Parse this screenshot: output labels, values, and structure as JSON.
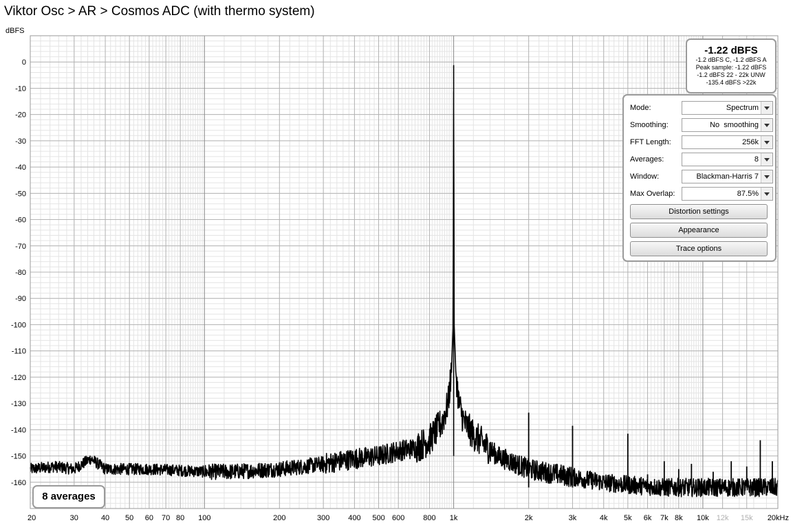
{
  "window": {
    "title": "Viktor Osc > AR > Cosmos ADC (with thermo system)"
  },
  "readout": {
    "level": "-1.22 dBFS",
    "lines": [
      "-1.2 dBFS C, -1.2 dBFS A",
      "Peak sample: -1.22 dBFS",
      "-1.2 dBFS 22 - 22k UNW",
      "-135.4 dBFS >22k"
    ]
  },
  "controls": {
    "mode": {
      "label": "Mode:",
      "value": "Spectrum"
    },
    "smoothing": {
      "label": "Smoothing:",
      "value": "No  smoothing"
    },
    "fft_length": {
      "label": "FFT Length:",
      "value": "256k"
    },
    "averages": {
      "label": "Averages:",
      "value": "8"
    },
    "window": {
      "label": "Window:",
      "value": "Blackman-Harris 7"
    },
    "max_overlap": {
      "label": "Max Overlap:",
      "value": "87.5%"
    },
    "buttons": {
      "distortion": "Distortion settings",
      "appearance": "Appearance",
      "trace": "Trace options"
    }
  },
  "status": {
    "averages_badge": "8 averages"
  },
  "colors": {
    "trace": "#000000",
    "grid_major": "#b4b4b4",
    "grid_minor": "#e4e4e4",
    "tick_gray": "#b0b0b0"
  },
  "chart_data": {
    "type": "line",
    "ylabel": "dBFS",
    "xlim": [
      20,
      20000
    ],
    "ylim": [
      -170,
      10
    ],
    "x_scale": "log",
    "grid": true,
    "y_ticks": [
      0,
      -10,
      -20,
      -30,
      -40,
      -50,
      -60,
      -70,
      -80,
      -90,
      -100,
      -110,
      -120,
      -130,
      -140,
      -150,
      -160
    ],
    "x_ticks": [
      {
        "v": 20,
        "label": "20"
      },
      {
        "v": 30,
        "label": "30"
      },
      {
        "v": 40,
        "label": "40"
      },
      {
        "v": 50,
        "label": "50"
      },
      {
        "v": 60,
        "label": "60"
      },
      {
        "v": 70,
        "label": "70"
      },
      {
        "v": 80,
        "label": "80"
      },
      {
        "v": 100,
        "label": "100"
      },
      {
        "v": 200,
        "label": "200"
      },
      {
        "v": 300,
        "label": "300"
      },
      {
        "v": 400,
        "label": "400"
      },
      {
        "v": 500,
        "label": "500"
      },
      {
        "v": 600,
        "label": "600"
      },
      {
        "v": 800,
        "label": "800"
      },
      {
        "v": 1000,
        "label": "1k"
      },
      {
        "v": 2000,
        "label": "2k"
      },
      {
        "v": 3000,
        "label": "3k"
      },
      {
        "v": 4000,
        "label": "4k"
      },
      {
        "v": 5000,
        "label": "5k"
      },
      {
        "v": 6000,
        "label": "6k"
      },
      {
        "v": 7000,
        "label": "7k"
      },
      {
        "v": 8000,
        "label": "8k"
      },
      {
        "v": 10000,
        "label": "10k"
      },
      {
        "v": 12000,
        "label": "12k",
        "muted": true
      },
      {
        "v": 15000,
        "label": "15k",
        "muted": true
      },
      {
        "v": 20000,
        "label": "20kHz"
      }
    ],
    "series": [
      {
        "points": [
          [
            20,
            -155
          ],
          [
            25,
            -154
          ],
          [
            30,
            -155
          ],
          [
            35,
            -151
          ],
          [
            40,
            -155
          ],
          [
            50,
            -155
          ],
          [
            60,
            -155
          ],
          [
            80,
            -155.5
          ],
          [
            100,
            -156
          ],
          [
            130,
            -156
          ],
          [
            160,
            -155.5
          ],
          [
            200,
            -155
          ],
          [
            250,
            -154
          ],
          [
            300,
            -153
          ],
          [
            400,
            -151
          ],
          [
            500,
            -150
          ],
          [
            600,
            -148
          ],
          [
            700,
            -147
          ],
          [
            800,
            -144
          ],
          [
            900,
            -137
          ],
          [
            950,
            -130
          ],
          [
            980,
            -118
          ],
          [
            995,
            -100
          ],
          [
            1000,
            -1.2
          ],
          [
            1005,
            -100
          ],
          [
            1020,
            -118
          ],
          [
            1050,
            -130
          ],
          [
            1100,
            -137
          ],
          [
            1200,
            -142
          ],
          [
            1500,
            -150
          ],
          [
            2000,
            -155
          ],
          [
            3000,
            -158
          ],
          [
            4000,
            -160
          ],
          [
            5000,
            -161
          ],
          [
            7000,
            -162
          ],
          [
            10000,
            -162
          ],
          [
            15000,
            -162
          ],
          [
            20000,
            -162
          ]
        ]
      }
    ],
    "spurs": [
      {
        "f": 2000,
        "db": -133.5
      },
      {
        "f": 3000,
        "db": -138.5
      },
      {
        "f": 5000,
        "db": -141.5
      },
      {
        "f": 6000,
        "db": -157
      },
      {
        "f": 7000,
        "db": -152
      },
      {
        "f": 8000,
        "db": -155
      },
      {
        "f": 9000,
        "db": -153
      },
      {
        "f": 11000,
        "db": -156
      },
      {
        "f": 13000,
        "db": -152
      },
      {
        "f": 15000,
        "db": -154
      },
      {
        "f": 17000,
        "db": -144
      },
      {
        "f": 19000,
        "db": -152
      }
    ]
  }
}
